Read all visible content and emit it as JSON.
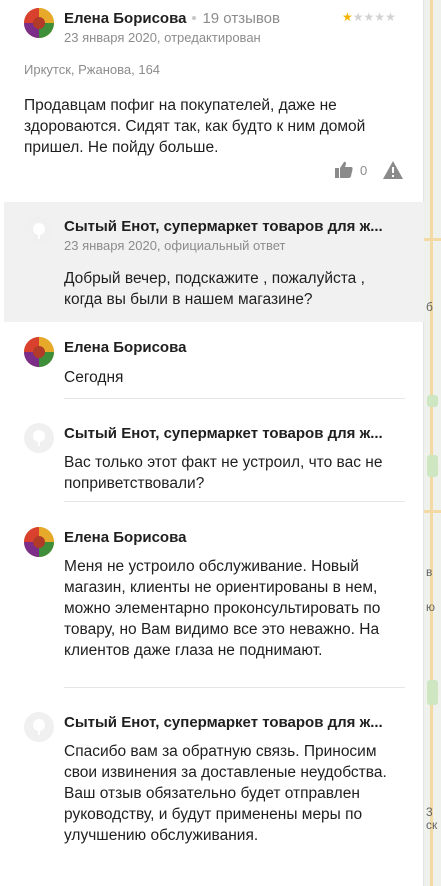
{
  "review": {
    "author": "Елена Борисова",
    "reviews_count": "19 отзывов",
    "date": "23 января 2020, отредактирован",
    "rating": 1,
    "rating_max": 5,
    "address": "Иркутск, Ржанова, 164",
    "text": "Продавцам пофиг на покупателей, даже не здороваются. Сидят так, как будто к ним домой пришел. Не пойду больше.",
    "likes": "0"
  },
  "official_reply": {
    "org_name": "Сытый Енот, супермаркет товаров для ж...",
    "date": "23 января 2020, официальный ответ",
    "text": "Добрый вечер, подскажите , пожалуйста , когда вы были в нашем магазине?"
  },
  "thread": [
    {
      "author": "Елена Борисова",
      "text": "Сегодня"
    },
    {
      "author": "Сытый Енот, супермаркет товаров для ж...",
      "text": "Вас только этот факт не устроил, что вас не поприветствовали?"
    },
    {
      "author": "Елена Борисова",
      "text": "Меня не устроило обслуживание. Новый магазин, клиенты не ориентированы в нем, можно элементарно проконсультировать по товару, но Вам видимо все это неважно. На клиентов даже глаза не поднимают."
    },
    {
      "author": "Сытый Енот, супермаркет товаров для ж...",
      "text": "Спасибо вам за обратную связь. Приносим свои извинения за доставленые неудобства. Ваш отзыв обязательно будет отправлен руководству, и будут применены меры по улучшению обслуживания."
    }
  ],
  "map_labels": [
    "б",
    "в",
    "ю",
    "3",
    "ск"
  ],
  "colors": {
    "star_active": "#f5b400",
    "star_inactive": "#d3d3d3",
    "reply_bg": "#f1f1f1",
    "muted": "#8c8c8c"
  }
}
